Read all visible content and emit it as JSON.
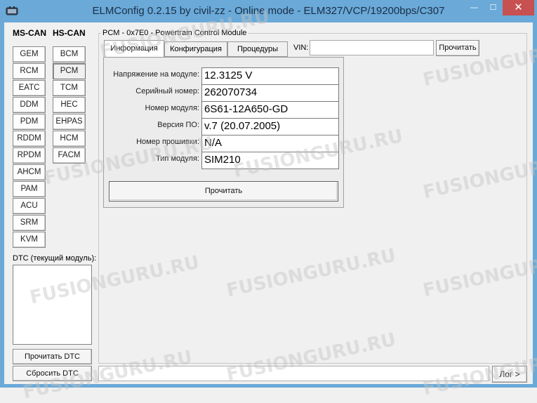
{
  "window": {
    "title": "ELMConfig 0.2.15 by civil-zz - Online mode - ELM327/VCP/19200bps/C307",
    "min_glyph": "—",
    "max_glyph": "☐",
    "close_glyph": "✕"
  },
  "modules": {
    "ms_can_title": "MS-CAN",
    "hs_can_title": "HS-CAN",
    "ms_can": [
      "GEM",
      "RCM",
      "EATC",
      "DDM",
      "PDM",
      "RDDM",
      "RPDM",
      "AHCM",
      "PAM",
      "ACU",
      "SRM",
      "KVM"
    ],
    "hs_can": [
      "BCM",
      "PCM",
      "TCM",
      "HEC",
      "EHPAS",
      "HCM",
      "FACM"
    ],
    "selected": "PCM"
  },
  "dtc": {
    "label": "DTC (текущий модуль):",
    "read_button": "Прочитать DTC",
    "clear_button": "Сбросить DTC"
  },
  "module_panel": {
    "title": "PCM - 0x7E0 - Powertrain Control Module",
    "tabs": [
      "Информация",
      "Конфигурация",
      "Процедуры"
    ],
    "active_tab": "Информация",
    "vin_label": "VIN:",
    "vin_value": "",
    "vin_read_button": "Прочитать",
    "info": [
      {
        "label": "Напряжение на модуле:",
        "value": "12.3125 V"
      },
      {
        "label": "Серийный номер:",
        "value": "262070734"
      },
      {
        "label": "Номер модуля:",
        "value": "6S61-12A650-GD"
      },
      {
        "label": "Версия ПО:",
        "value": "v.7 (20.07.2005)"
      },
      {
        "label": "Номер прошивки:",
        "value": "N/A"
      },
      {
        "label": "Тип модуля:",
        "value": "SIM210"
      }
    ],
    "read_button": "Прочитать"
  },
  "status_bar": {
    "log_text": "",
    "log_button": "Лог >"
  },
  "watermark": "FUSIONGURU.RU",
  "colors": {
    "titlebar": "#6aa9d8",
    "close_button": "#c75050",
    "window_bg": "#f0f0f0"
  }
}
